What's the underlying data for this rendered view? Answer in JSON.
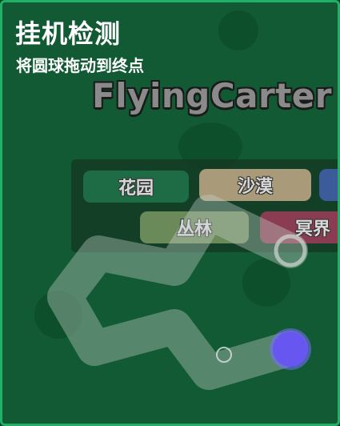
{
  "header": {
    "title": "挂机检测",
    "subtitle": "将圆球拖动到终点",
    "watermark": "FlyingCarter"
  },
  "map_options": [
    "花园",
    "沙漠",
    "",
    "丛林",
    "冥界"
  ],
  "colors": {
    "background": "#115a33",
    "border": "#22b067",
    "ball": "#6757f0",
    "path": "#b9c7bd"
  },
  "icons": {
    "ball": "drag-ball",
    "start": "start-ring",
    "goal": "goal-ring"
  }
}
